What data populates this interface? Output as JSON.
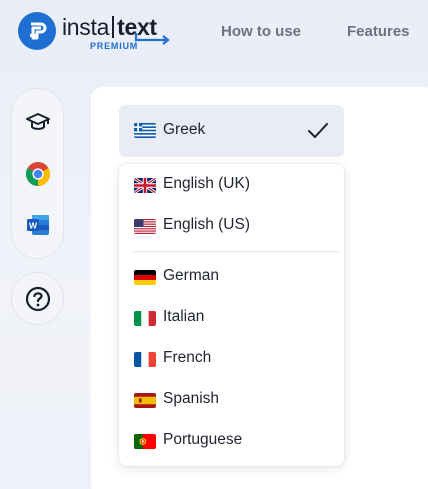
{
  "header": {
    "logo": {
      "word_left": "insta",
      "word_right": "text",
      "sub": "PREMIUM",
      "icon": "instatext-logo-icon"
    },
    "nav": [
      {
        "label": "How to use"
      },
      {
        "label": "Features"
      }
    ]
  },
  "rail": {
    "icons": [
      "graduation-cap-icon",
      "chrome-icon",
      "word-icon"
    ],
    "help_icon": "question-circle-icon"
  },
  "language_select": {
    "selected": {
      "label": "Greek",
      "flag": "greece-flag-icon"
    },
    "check_icon": "check-icon",
    "options": [
      {
        "label": "English (UK)",
        "flag": "uk-flag-icon"
      },
      {
        "label": "English (US)",
        "flag": "us-flag-icon"
      },
      {
        "label": "German",
        "flag": "germany-flag-icon"
      },
      {
        "label": "Italian",
        "flag": "italy-flag-icon"
      },
      {
        "label": "French",
        "flag": "france-flag-icon"
      },
      {
        "label": "Spanish",
        "flag": "spain-flag-icon"
      },
      {
        "label": "Portuguese",
        "flag": "portugal-flag-icon"
      }
    ]
  },
  "colors": {
    "brand_blue": "#1e6fd1",
    "selected_bg": "#e9ecf5",
    "nav_text": "#6b7280"
  }
}
